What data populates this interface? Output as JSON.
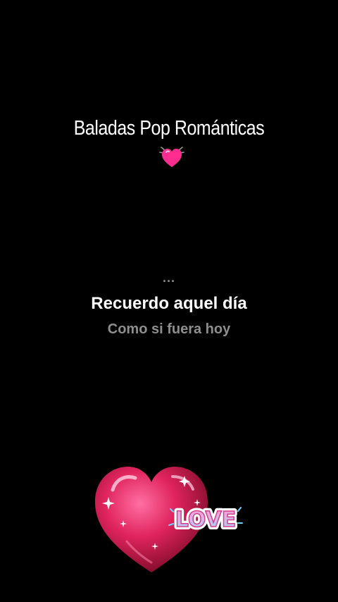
{
  "overlay": {
    "title": "Baladas Pop Románticas",
    "title_emoji": "heart-beating-emoji"
  },
  "lyrics": {
    "indicator": "...",
    "current_line": "Recuerdo aquel día",
    "next_line": "Como si fuera hoy"
  },
  "sticker": {
    "icon": "heart-love-sticker",
    "text": "LOVE"
  },
  "colors": {
    "background": "#000000",
    "heart_pink": "#ff2d8f",
    "heart_red": "#b3123f",
    "current_lyric": "#ffffff",
    "next_lyric": "#8e8e8e"
  }
}
